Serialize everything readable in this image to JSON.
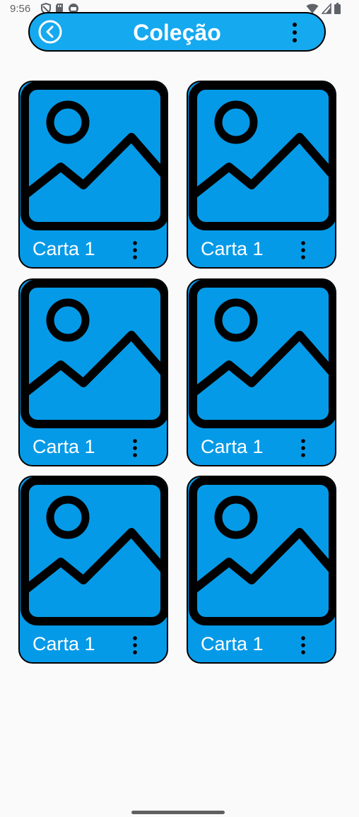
{
  "status_bar": {
    "time": "9:56",
    "left_icons": [
      "shield-icon",
      "sd-card-icon",
      "app-notification-icon"
    ],
    "right_icons": [
      "wifi-icon",
      "signal-icon",
      "battery-icon"
    ]
  },
  "app_bar": {
    "title": "Coleção",
    "back_icon": "back-arrow-circle-icon",
    "menu_icon": "more-vert-icon",
    "background": "#15a9ef"
  },
  "cards": [
    {
      "label": "Carta 1",
      "image_icon": "image-placeholder-icon",
      "menu_icon": "more-vert-icon"
    },
    {
      "label": "Carta 1",
      "image_icon": "image-placeholder-icon",
      "menu_icon": "more-vert-icon"
    },
    {
      "label": "Carta 1",
      "image_icon": "image-placeholder-icon",
      "menu_icon": "more-vert-icon"
    },
    {
      "label": "Carta 1",
      "image_icon": "image-placeholder-icon",
      "menu_icon": "more-vert-icon"
    },
    {
      "label": "Carta 1",
      "image_icon": "image-placeholder-icon",
      "menu_icon": "more-vert-icon"
    },
    {
      "label": "Carta 1",
      "image_icon": "image-placeholder-icon",
      "menu_icon": "more-vert-icon"
    }
  ],
  "colors": {
    "card_background": "#059ae7",
    "page_background": "#fafafa",
    "outline": "#000000"
  }
}
